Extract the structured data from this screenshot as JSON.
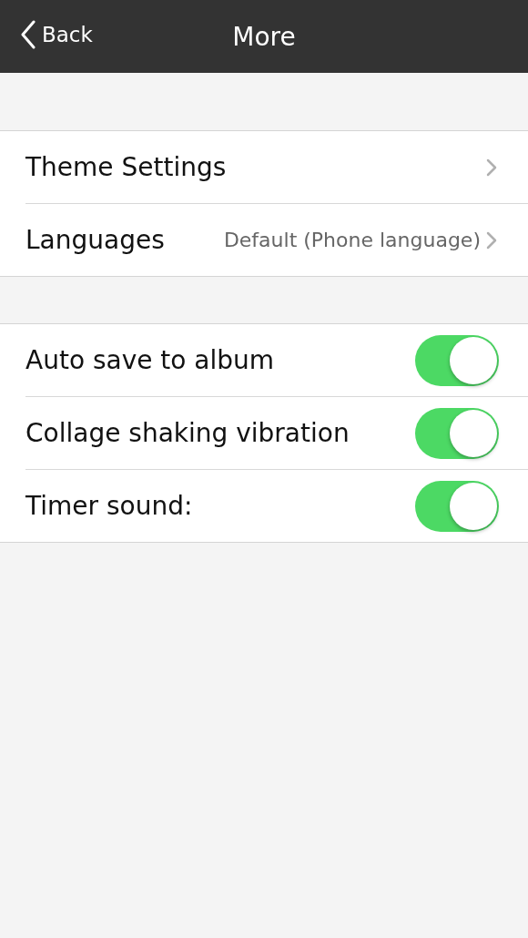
{
  "nav": {
    "back": "Back",
    "title": "More"
  },
  "groups": [
    {
      "rows": [
        {
          "kind": "link",
          "label": "Theme Settings"
        },
        {
          "kind": "link",
          "label": "Languages",
          "detail": "Default (Phone language)"
        }
      ]
    },
    {
      "rows": [
        {
          "kind": "toggle",
          "label": "Auto save to album",
          "on": true
        },
        {
          "kind": "toggle",
          "label": "Collage shaking vibration",
          "on": true
        },
        {
          "kind": "toggle",
          "label": "Timer sound:",
          "on": true
        }
      ]
    }
  ]
}
